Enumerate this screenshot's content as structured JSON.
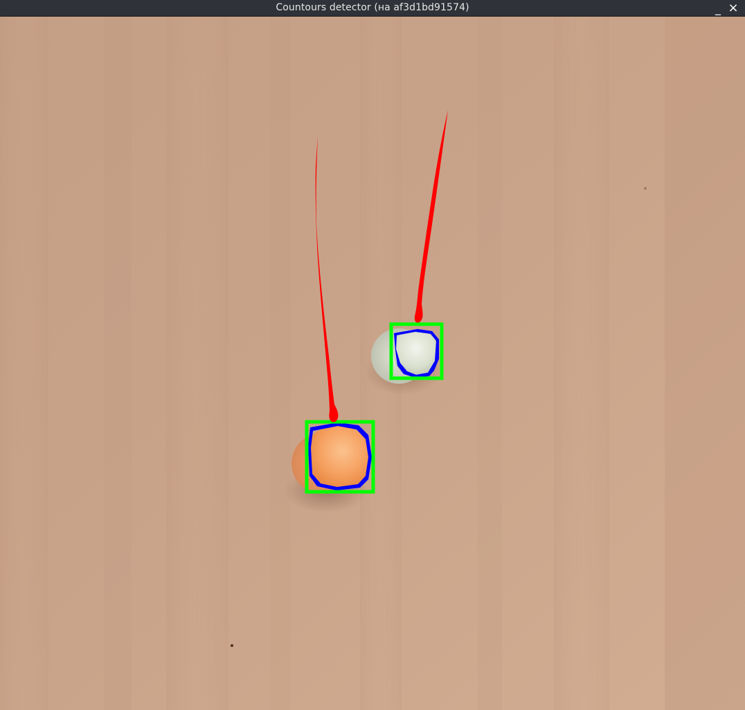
{
  "window": {
    "title": "Countours detector (на af3d1bd91574)",
    "controls": {
      "minimize_glyph": "_",
      "close_glyph": "×"
    }
  },
  "colors": {
    "titlebar_bg": "#2f3238",
    "wood_base": "#c9a48a",
    "bounding_box": "#00ff00",
    "contour": "#0000ff",
    "trajectory": "#ff0000",
    "orange_ball": "#f7a060",
    "white_ball": "#dfe3d2"
  }
}
